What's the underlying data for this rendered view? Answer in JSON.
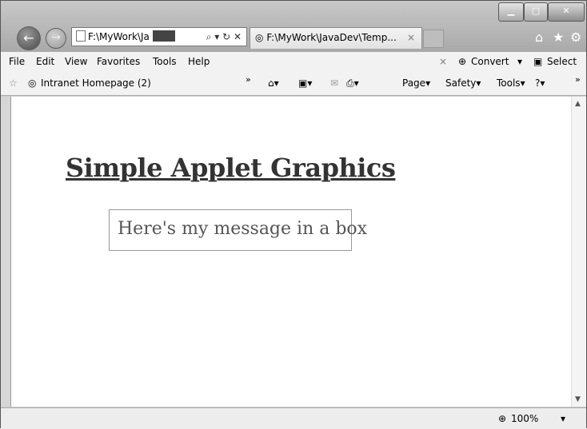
{
  "browser": {
    "address_text": "F:\\MyWork\\Ja",
    "tab_title": "F:\\MyWork\\JavaDev\\Temp...",
    "tab_close": "×",
    "address_search": "⌕ ▾ ↻ ✕"
  },
  "menu": {
    "items": [
      "File",
      "Edit",
      "View",
      "Favorites",
      "Tools",
      "Help"
    ],
    "close_x": "×",
    "convert": "Convert",
    "select": "Select"
  },
  "favorites_bar": {
    "item": "Intranet Homepage (2)",
    "chevron": "»",
    "page": "Page",
    "safety": "Safety",
    "tools": "Tools"
  },
  "page": {
    "heading": "Simple Applet Graphics",
    "message": "Here's my message in a box"
  },
  "status": {
    "zoom": "100%"
  }
}
